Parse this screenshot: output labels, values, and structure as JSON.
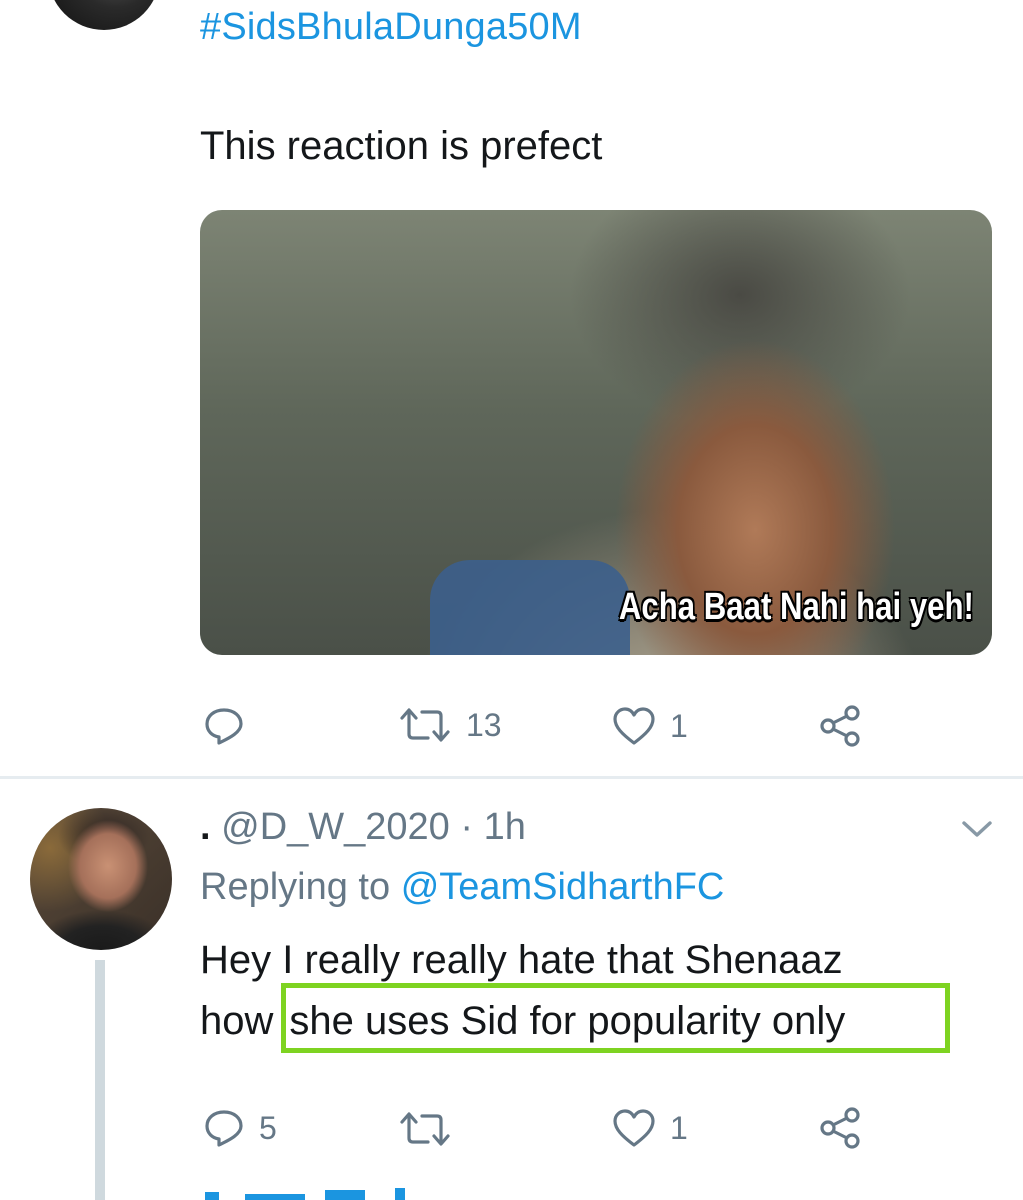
{
  "tweet1": {
    "hashtag": "#SidsBhulaDunga50M",
    "text": "This reaction is prefect",
    "media_caption": "Acha Baat Nahi hai yeh!",
    "actions": {
      "reply_count": "",
      "retweet_count": "13",
      "like_count": "1"
    }
  },
  "reply": {
    "separator": ".",
    "handle": "@D_W_2020",
    "meta_sep": "·",
    "time": "1h",
    "replying_prefix": "Replying to",
    "replying_to": "@TeamSidharthFC",
    "body_line1": "Hey I really really hate that Shenaaz",
    "body_line2_start": "how",
    "body_line2_highlight": "she uses Sid for popularity only",
    "actions": {
      "reply_count": "5",
      "retweet_count": "",
      "like_count": "1"
    }
  },
  "colors": {
    "link": "#1b95e0",
    "secondary": "#657786",
    "highlight_box": "#7ed321",
    "divider": "#e6ecf0"
  },
  "icons": [
    "reply-icon",
    "retweet-icon",
    "like-icon",
    "share-icon",
    "caret-down-icon"
  ]
}
